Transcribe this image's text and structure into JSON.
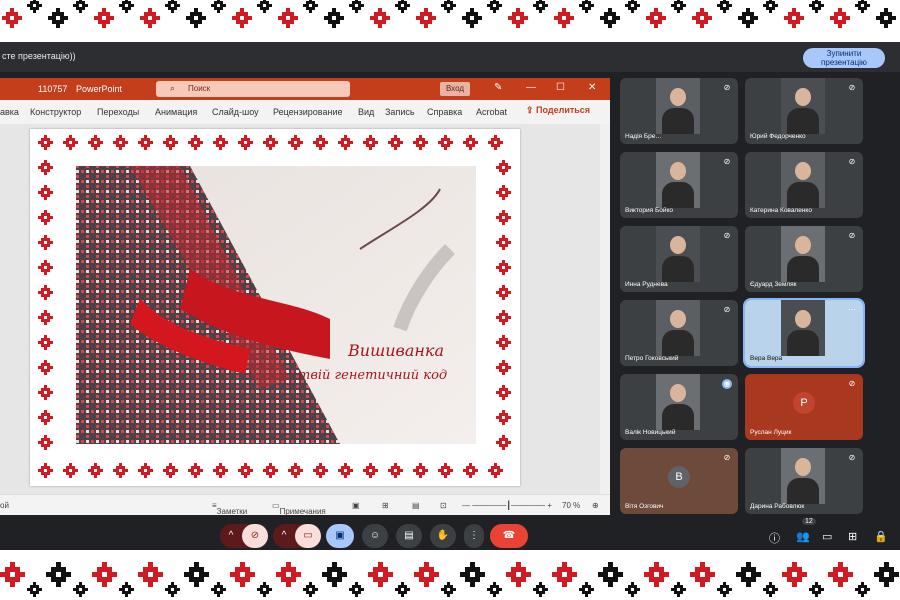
{
  "meet": {
    "share_text": "сте презентацію))",
    "stop_share": "Зупинити презентацію"
  },
  "ppt": {
    "doc_name": "110757",
    "app_name": "PowerPoint",
    "search_placeholder": "Поиск",
    "signin": "Вход",
    "share": "Поделиться",
    "tabs": [
      "авка",
      "Конструктор",
      "Переходы",
      "Анимация",
      "Слайд-шоу",
      "Рецензирование",
      "Вид",
      "Запись",
      "Справка",
      "Acrobat"
    ],
    "status_left": "ой",
    "notes": "Заметки",
    "comments": "Примечания",
    "zoom": "70 %"
  },
  "slide": {
    "title_line1": "Вишиванка",
    "title_line2": "твій генетичний код"
  },
  "participants": [
    {
      "name": "Надія Бре…",
      "type": "video"
    },
    {
      "name": "Юрий Федорченко",
      "type": "video"
    },
    {
      "name": "Виктория Бойко",
      "type": "video"
    },
    {
      "name": "Катерина Коваленко",
      "type": "video"
    },
    {
      "name": "Инна Руднева",
      "type": "video"
    },
    {
      "name": "Єдуард Земляк",
      "type": "video"
    },
    {
      "name": "Петро Гоковський",
      "type": "video"
    },
    {
      "name": "Вера Вера",
      "type": "video"
    },
    {
      "name": "Валік Новицький",
      "type": "video"
    },
    {
      "name": "Руслан Луцик",
      "type": "avatar",
      "initial": "Р"
    },
    {
      "name": "Вітя Озгович",
      "type": "avatar",
      "initial": "В"
    },
    {
      "name": "Дарина Рабовлюк",
      "type": "video"
    }
  ],
  "participant_count": "12",
  "colors": {
    "accent": "#c43e1c",
    "meet_bg": "#202124",
    "stop": "#a8c7fa",
    "end_call": "#ea4335"
  }
}
